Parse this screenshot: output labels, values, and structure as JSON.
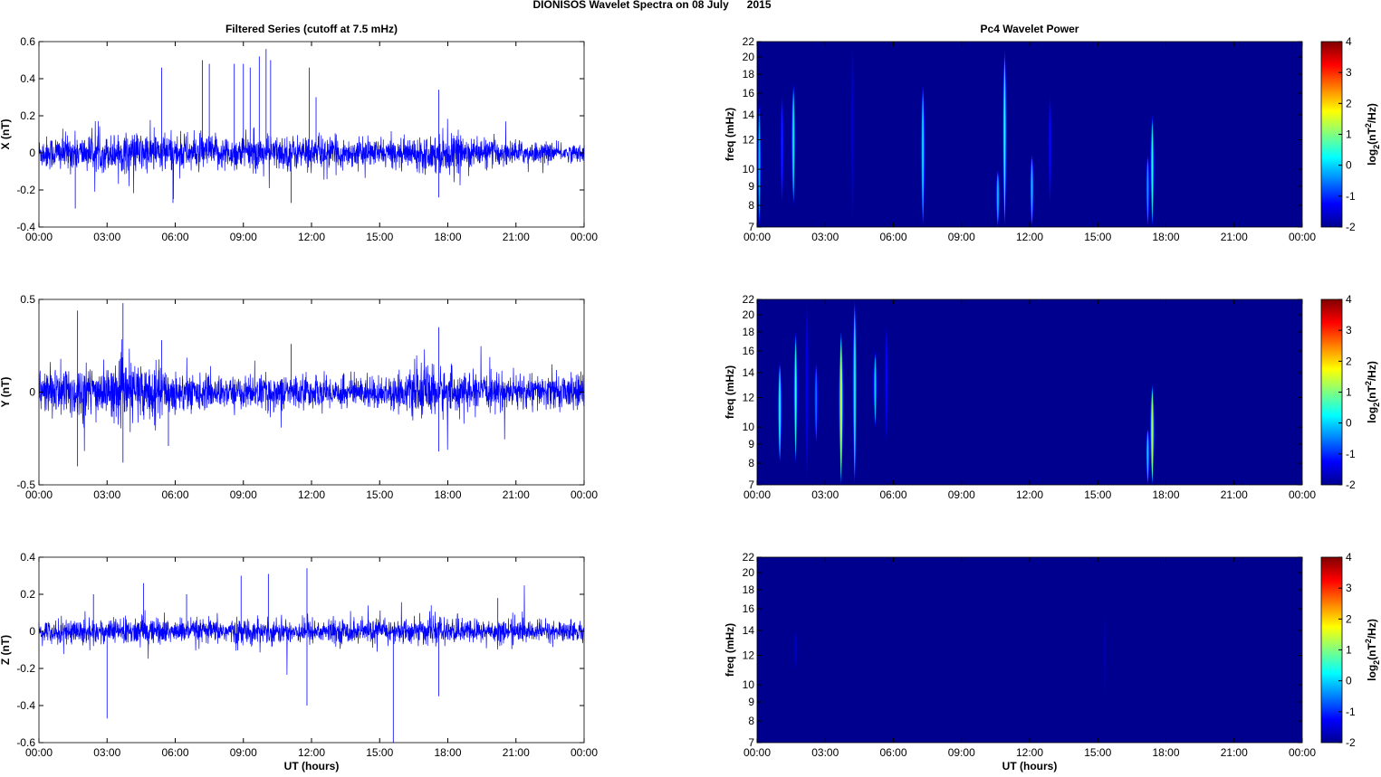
{
  "title": "DIONISOS Wavelet Spectra on 08 July      2015",
  "left_title": "Filtered Series (cutoff at 7.5 mHz)",
  "right_title": "Pc4 Wavelet Power",
  "xlabel": "UT (hours)",
  "chart_data": [
    {
      "type": "line",
      "name": "X",
      "ylabel": "X (nT)",
      "xlim": [
        0,
        24
      ],
      "ylim": [
        -0.4,
        0.6
      ],
      "yticks": [
        "-0.4",
        "-0.2",
        "0",
        "0.2",
        "0.4",
        "0.6"
      ],
      "ytick_values": [
        -0.4,
        -0.2,
        0,
        0.2,
        0.4,
        0.6
      ],
      "xticks": [
        "00:00",
        "03:00",
        "06:00",
        "09:00",
        "12:00",
        "15:00",
        "18:00",
        "21:00",
        "00:00"
      ],
      "noise_envelope_hourly": [
        0.09,
        0.11,
        0.1,
        0.1,
        0.12,
        0.12,
        0.11,
        0.1,
        0.1,
        0.1,
        0.1,
        0.1,
        0.1,
        0.09,
        0.08,
        0.08,
        0.08,
        0.1,
        0.12,
        0.09,
        0.08,
        0.07,
        0.06,
        0.05,
        0.05
      ],
      "spikes": [
        [
          5.4,
          0.46
        ],
        [
          7.2,
          0.5
        ],
        [
          7.5,
          0.48
        ],
        [
          8.6,
          0.48
        ],
        [
          9.0,
          0.48
        ],
        [
          9.3,
          0.46
        ],
        [
          9.7,
          0.52
        ],
        [
          10.0,
          0.56
        ],
        [
          10.2,
          0.5
        ],
        [
          11.9,
          0.46
        ],
        [
          12.2,
          0.3
        ],
        [
          17.6,
          0.34
        ],
        [
          1.6,
          -0.3
        ],
        [
          5.9,
          -0.27
        ],
        [
          11.1,
          -0.27
        ],
        [
          17.6,
          -0.24
        ]
      ]
    },
    {
      "type": "line",
      "name": "Y",
      "ylabel": "Y (nT)",
      "xlim": [
        0,
        24
      ],
      "ylim": [
        -0.5,
        0.5
      ],
      "yticks": [
        "-0.5",
        "0",
        "0.5"
      ],
      "ytick_values": [
        -0.5,
        0,
        0.5
      ],
      "xticks": [
        "00:00",
        "03:00",
        "06:00",
        "09:00",
        "12:00",
        "15:00",
        "18:00",
        "21:00",
        "00:00"
      ],
      "noise_envelope_hourly": [
        0.12,
        0.16,
        0.16,
        0.14,
        0.18,
        0.16,
        0.12,
        0.1,
        0.09,
        0.09,
        0.1,
        0.1,
        0.09,
        0.09,
        0.09,
        0.09,
        0.1,
        0.16,
        0.13,
        0.1,
        0.1,
        0.1,
        0.1,
        0.1,
        0.1
      ],
      "spikes": [
        [
          1.7,
          0.44
        ],
        [
          3.7,
          0.48
        ],
        [
          5.4,
          0.28
        ],
        [
          11.1,
          0.26
        ],
        [
          17.6,
          0.35
        ],
        [
          1.7,
          -0.4
        ],
        [
          3.7,
          -0.38
        ],
        [
          5.7,
          -0.29
        ],
        [
          17.6,
          -0.32
        ]
      ]
    },
    {
      "type": "line",
      "name": "Z",
      "ylabel": "Z (nT)",
      "xlim": [
        0,
        24
      ],
      "ylim": [
        -0.6,
        0.4
      ],
      "yticks": [
        "-0.6",
        "-0.4",
        "-0.2",
        "0",
        "0.2",
        "0.4"
      ],
      "ytick_values": [
        -0.6,
        -0.4,
        -0.2,
        0,
        0.2,
        0.4
      ],
      "xticks": [
        "00:00",
        "03:00",
        "06:00",
        "09:00",
        "12:00",
        "15:00",
        "18:00",
        "21:00",
        "00:00"
      ],
      "noise_envelope_hourly": [
        0.06,
        0.07,
        0.08,
        0.07,
        0.08,
        0.08,
        0.07,
        0.07,
        0.07,
        0.07,
        0.07,
        0.07,
        0.07,
        0.07,
        0.07,
        0.07,
        0.07,
        0.08,
        0.07,
        0.07,
        0.07,
        0.07,
        0.06,
        0.06,
        0.06
      ],
      "spikes": [
        [
          3.0,
          -0.47
        ],
        [
          11.8,
          -0.4
        ],
        [
          15.6,
          -0.6
        ],
        [
          17.6,
          -0.35
        ],
        [
          11.8,
          0.34
        ],
        [
          10.1,
          0.31
        ],
        [
          8.9,
          0.3
        ],
        [
          4.6,
          0.26
        ],
        [
          2.4,
          0.2
        ],
        [
          6.5,
          0.2
        ],
        [
          20.2,
          0.18
        ]
      ]
    },
    {
      "type": "heatmap",
      "name": "X power",
      "ylabel": "freq (mHz)",
      "xlim": [
        0,
        24
      ],
      "ylim": [
        7,
        22
      ],
      "yscale": "log",
      "yticks": [
        "7",
        "8",
        "9",
        "10",
        "12",
        "14",
        "16",
        "18",
        "20",
        "22"
      ],
      "ytick_values": [
        7,
        8,
        9,
        10,
        12,
        14,
        16,
        18,
        20,
        22
      ],
      "xticks": [
        "00:00",
        "03:00",
        "06:00",
        "09:00",
        "12:00",
        "15:00",
        "18:00",
        "21:00",
        "00:00"
      ],
      "colorbar": {
        "label": "log2(nT2/Hz)",
        "range": [
          -2,
          4
        ],
        "ticks": [
          "-2",
          "-1",
          "0",
          "1",
          "2",
          "3",
          "4"
        ]
      },
      "background": -2,
      "bursts": [
        [
          0.1,
          7,
          15,
          -0.2
        ],
        [
          1.1,
          8,
          16,
          -1
        ],
        [
          1.6,
          8,
          17,
          0.3
        ],
        [
          7.3,
          7,
          17,
          0.2
        ],
        [
          10.6,
          7,
          10,
          0
        ],
        [
          10.9,
          7,
          21,
          0.5
        ],
        [
          12.1,
          7,
          11,
          0
        ],
        [
          12.9,
          8,
          16,
          -1.2
        ],
        [
          17.2,
          7,
          11,
          -0.3
        ],
        [
          17.4,
          7,
          14,
          0.4
        ],
        [
          4.2,
          7,
          22,
          -1.5
        ]
      ]
    },
    {
      "type": "heatmap",
      "name": "Y power",
      "ylabel": "freq (mHz)",
      "xlim": [
        0,
        24
      ],
      "ylim": [
        7,
        22
      ],
      "yscale": "log",
      "yticks": [
        "7",
        "8",
        "9",
        "10",
        "12",
        "14",
        "16",
        "18",
        "20",
        "22"
      ],
      "ytick_values": [
        7,
        8,
        9,
        10,
        12,
        14,
        16,
        18,
        20,
        22
      ],
      "xticks": [
        "00:00",
        "03:00",
        "06:00",
        "09:00",
        "12:00",
        "15:00",
        "18:00",
        "21:00",
        "00:00"
      ],
      "colorbar": {
        "label": "log2(nT2/Hz)",
        "range": [
          -2,
          4
        ],
        "ticks": [
          "-2",
          "-1",
          "0",
          "1",
          "2",
          "3",
          "4"
        ]
      },
      "background": -2,
      "bursts": [
        [
          1.0,
          8,
          15,
          0.5
        ],
        [
          1.7,
          8,
          18,
          0.5
        ],
        [
          2.6,
          9,
          15,
          -0.5
        ],
        [
          3.7,
          7,
          18,
          1.5
        ],
        [
          4.3,
          7,
          22,
          0.5
        ],
        [
          5.2,
          10,
          16,
          0
        ],
        [
          5.7,
          9,
          19,
          -1.2
        ],
        [
          2.2,
          7,
          22,
          -1.3
        ],
        [
          17.4,
          7,
          13,
          1.2
        ],
        [
          17.2,
          7,
          10,
          0
        ]
      ]
    },
    {
      "type": "heatmap",
      "name": "Z power",
      "ylabel": "freq (mHz)",
      "xlim": [
        0,
        24
      ],
      "ylim": [
        7,
        22
      ],
      "yscale": "log",
      "yticks": [
        "7",
        "8",
        "9",
        "10",
        "12",
        "14",
        "16",
        "18",
        "20",
        "22"
      ],
      "ytick_values": [
        7,
        8,
        9,
        10,
        12,
        14,
        16,
        18,
        20,
        22
      ],
      "xticks": [
        "00:00",
        "03:00",
        "06:00",
        "09:00",
        "12:00",
        "15:00",
        "18:00",
        "21:00",
        "00:00"
      ],
      "colorbar": {
        "label": "log2(nT2/Hz)",
        "range": [
          -2,
          4
        ],
        "ticks": [
          "-2",
          "-1",
          "0",
          "1",
          "2",
          "3",
          "4"
        ]
      },
      "background": -2,
      "bursts": [
        [
          1.7,
          11,
          14,
          -1.6
        ],
        [
          15.3,
          9,
          16,
          -1.7
        ]
      ]
    }
  ]
}
